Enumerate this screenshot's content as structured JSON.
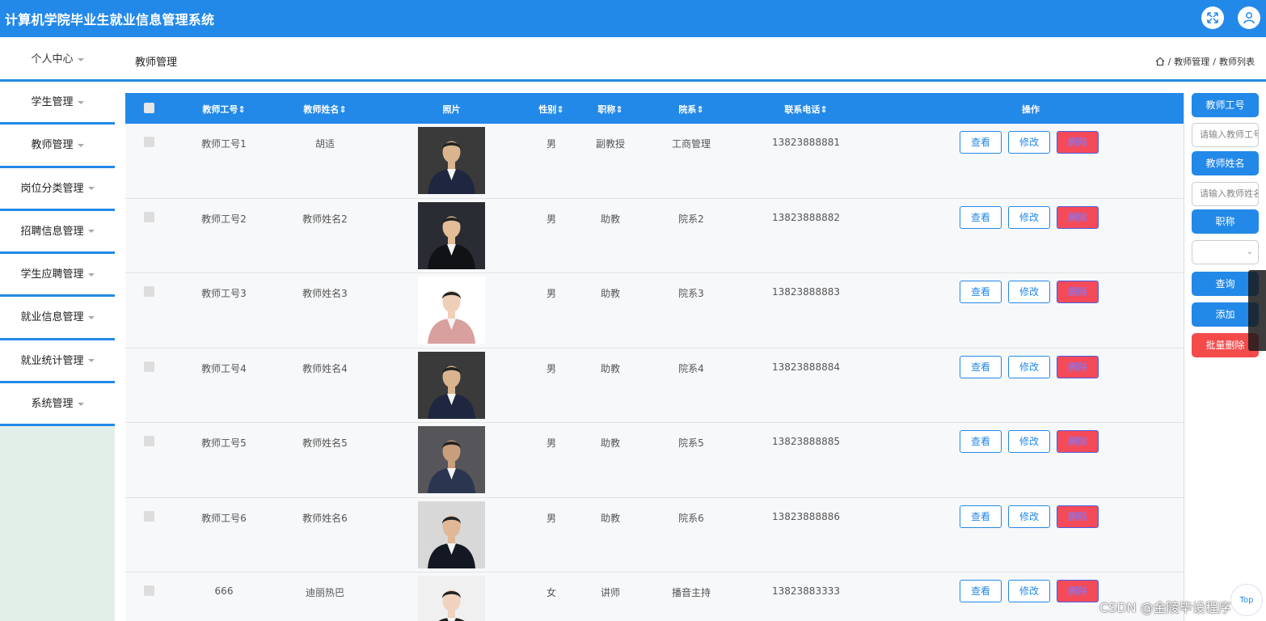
{
  "header": {
    "title": "计算机学院毕业生就业信息管理系统",
    "expand_icon": "expand-icon",
    "user_icon": "user-icon"
  },
  "subbar": {
    "personal_menu": "个人中心",
    "page_title": "教师管理",
    "breadcrumb": [
      "教师管理",
      "教师列表"
    ]
  },
  "sidebar": {
    "items": [
      {
        "label": "学生管理"
      },
      {
        "label": "教师管理"
      },
      {
        "label": "岗位分类管理"
      },
      {
        "label": "招聘信息管理"
      },
      {
        "label": "学生应聘管理"
      },
      {
        "label": "就业信息管理"
      },
      {
        "label": "就业统计管理"
      },
      {
        "label": "系统管理"
      }
    ]
  },
  "table": {
    "headers": {
      "id": "教师工号",
      "name": "教师姓名",
      "photo": "照片",
      "gender": "性别",
      "title": "职称",
      "dept": "院系",
      "phone": "联系电话",
      "ops": "操作"
    },
    "actions": {
      "view": "查看",
      "edit": "修改",
      "delete": "删除"
    },
    "rows": [
      {
        "id": "教师工号1",
        "name": "胡适",
        "gender": "男",
        "title": "副教授",
        "dept": "工商管理",
        "phone": "13823888881"
      },
      {
        "id": "教师工号2",
        "name": "教师姓名2",
        "gender": "男",
        "title": "助教",
        "dept": "院系2",
        "phone": "13823888882"
      },
      {
        "id": "教师工号3",
        "name": "教师姓名3",
        "gender": "男",
        "title": "助教",
        "dept": "院系3",
        "phone": "13823888883"
      },
      {
        "id": "教师工号4",
        "name": "教师姓名4",
        "gender": "男",
        "title": "助教",
        "dept": "院系4",
        "phone": "13823888884"
      },
      {
        "id": "教师工号5",
        "name": "教师姓名5",
        "gender": "男",
        "title": "助教",
        "dept": "院系5",
        "phone": "13823888885"
      },
      {
        "id": "教师工号6",
        "name": "教师姓名6",
        "gender": "男",
        "title": "助教",
        "dept": "院系6",
        "phone": "13823888886"
      },
      {
        "id": "666",
        "name": "迪丽热巴",
        "gender": "女",
        "title": "讲师",
        "dept": "播音主持",
        "phone": "13823883333"
      }
    ]
  },
  "search": {
    "teacher_id_label": "教师工号",
    "teacher_id_placeholder": "请输入教师工号",
    "teacher_name_label": "教师姓名",
    "teacher_name_placeholder": "请输入教师姓名",
    "title_label": "职称",
    "title_value": "",
    "query_button": "查询",
    "add_button": "添加",
    "batch_delete_button": "批量删除"
  },
  "misc": {
    "top_button": "Top",
    "watermark": "CSDN @金陵毕设程序"
  }
}
